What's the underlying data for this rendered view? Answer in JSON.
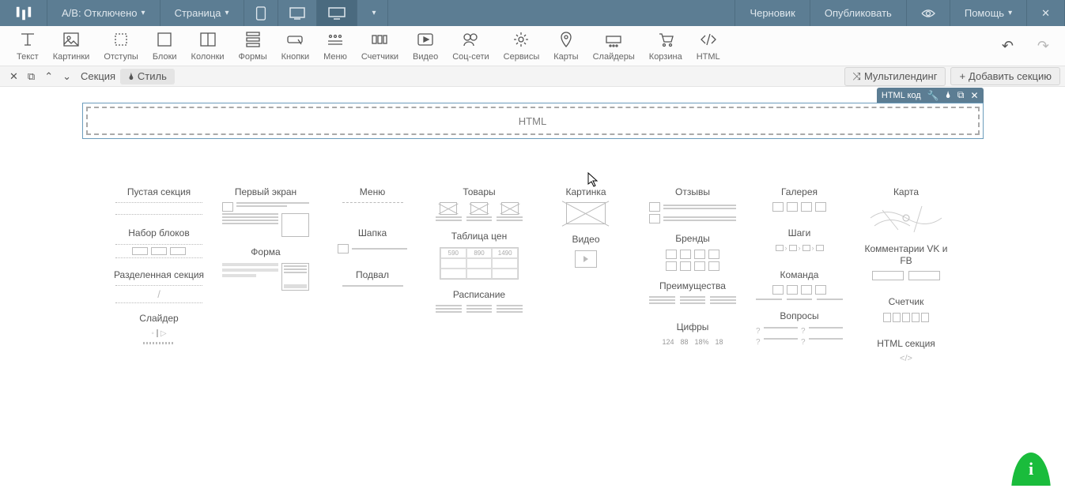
{
  "topbar": {
    "ab_label": "A/B: Отключено",
    "page_label": "Страница",
    "status": "Черновик",
    "publish": "Опубликовать",
    "help": "Помощь"
  },
  "tools": {
    "text": "Текст",
    "images": "Картинки",
    "spacing": "Отступы",
    "blocks": "Блоки",
    "columns": "Колонки",
    "forms": "Формы",
    "buttons": "Кнопки",
    "menu": "Меню",
    "counters": "Счетчики",
    "video": "Видео",
    "social": "Соц-сети",
    "services": "Сервисы",
    "maps": "Карты",
    "sliders": "Слайдеры",
    "cart": "Корзина",
    "html": "HTML"
  },
  "sectionbar": {
    "section": "Секция",
    "style": "Стиль",
    "multilanding": "Мультилендинг",
    "add_section": "Добавить секцию"
  },
  "html_block": {
    "toolbar_label": "HTML код",
    "placeholder": "HTML"
  },
  "templates": {
    "col1": [
      "Пустая секция",
      "Набор блоков",
      "Разделенная секция",
      "Слайдер"
    ],
    "col2": [
      "Первый экран",
      "Форма"
    ],
    "col3": [
      "Меню",
      "Шапка",
      "Подвал"
    ],
    "col4": [
      "Товары",
      "Таблица цен",
      "Расписание"
    ],
    "col5": [
      "Картинка",
      "Видео"
    ],
    "col6": [
      "Отзывы",
      "Бренды",
      "Преимущества",
      "Цифры"
    ],
    "col7": [
      "Галерея",
      "Шаги",
      "Команда",
      "Вопросы"
    ],
    "col8": [
      "Карта",
      "Комментарии VK и FB",
      "Счетчик",
      "HTML секция"
    ]
  },
  "pricetable": {
    "r1": [
      "590",
      "890",
      "1490"
    ]
  },
  "digits": [
    "124",
    "88",
    "18%",
    "18"
  ]
}
